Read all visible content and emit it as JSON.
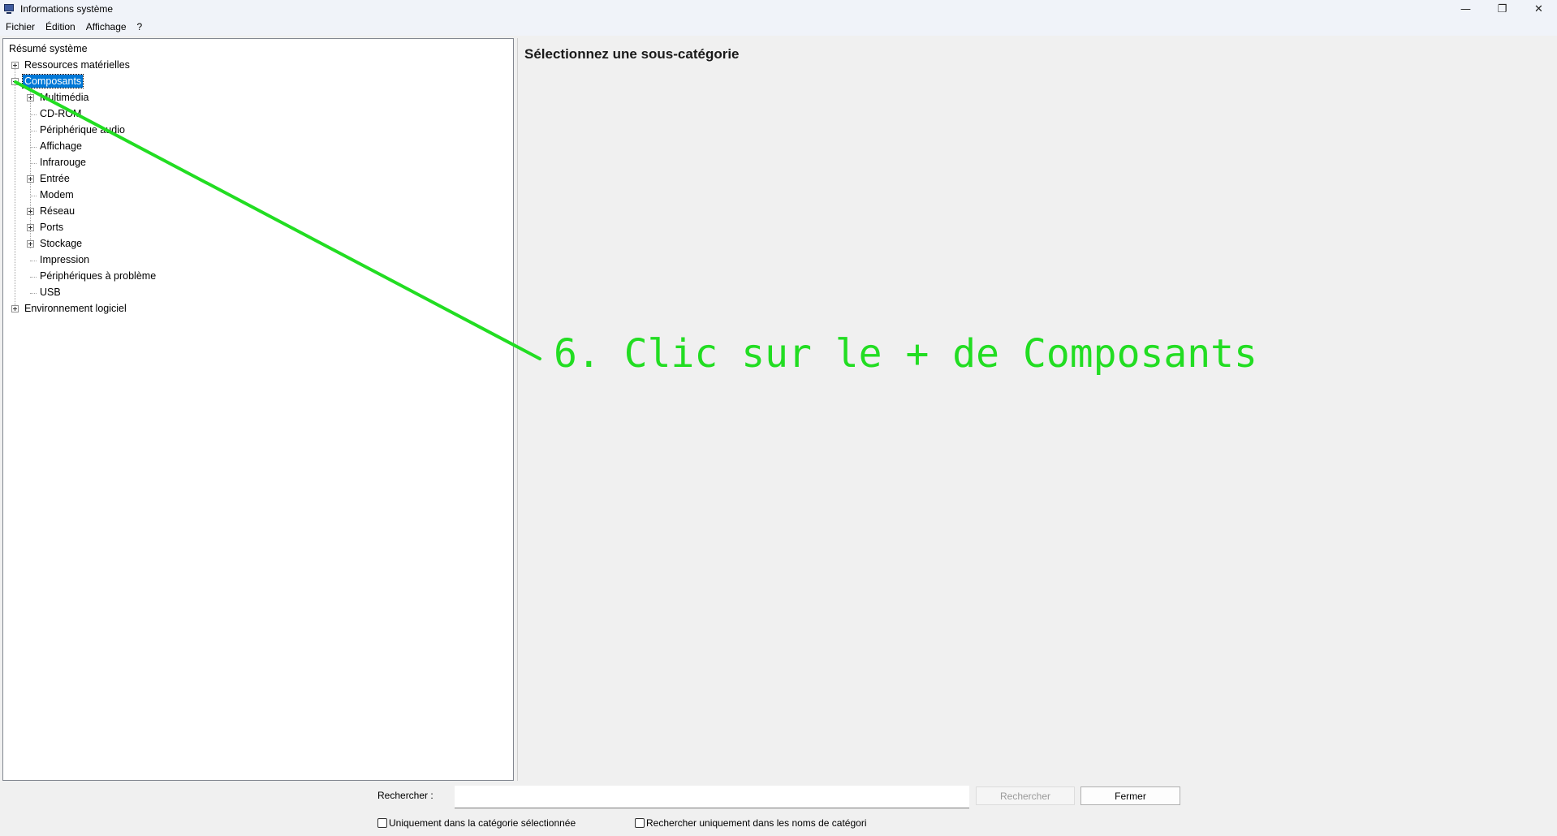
{
  "window": {
    "title": "Informations système",
    "controls": {
      "minimize": "—",
      "maximize": "❐",
      "close": "✕"
    }
  },
  "menu": [
    "Fichier",
    "Édition",
    "Affichage",
    "?"
  ],
  "tree": [
    {
      "label": "Résumé système",
      "level": 0,
      "expander": "none"
    },
    {
      "label": "Ressources matérielles",
      "level": 0,
      "expander": "plus"
    },
    {
      "label": "Composants",
      "level": 0,
      "expander": "minus",
      "selected": true
    },
    {
      "label": "Multimédia",
      "level": 1,
      "expander": "plus"
    },
    {
      "label": "CD-ROM",
      "level": 1,
      "expander": "none"
    },
    {
      "label": "Périphérique audio",
      "level": 1,
      "expander": "none"
    },
    {
      "label": "Affichage",
      "level": 1,
      "expander": "none"
    },
    {
      "label": "Infrarouge",
      "level": 1,
      "expander": "none"
    },
    {
      "label": "Entrée",
      "level": 1,
      "expander": "plus"
    },
    {
      "label": "Modem",
      "level": 1,
      "expander": "none"
    },
    {
      "label": "Réseau",
      "level": 1,
      "expander": "plus"
    },
    {
      "label": "Ports",
      "level": 1,
      "expander": "plus"
    },
    {
      "label": "Stockage",
      "level": 1,
      "expander": "plus"
    },
    {
      "label": "Impression",
      "level": 1,
      "expander": "none"
    },
    {
      "label": "Périphériques à problème",
      "level": 1,
      "expander": "none"
    },
    {
      "label": "USB",
      "level": 1,
      "expander": "none"
    },
    {
      "label": "Environnement logiciel",
      "level": 0,
      "expander": "plus"
    }
  ],
  "content": {
    "heading": "Sélectionnez une sous-catégorie"
  },
  "search": {
    "label": "Rechercher :",
    "value": "",
    "search_button": "Rechercher",
    "close_button": "Fermer",
    "checkbox_category": "Uniquement dans la catégorie sélectionnée",
    "checkbox_names": "Rechercher uniquement dans les noms de catégori"
  },
  "annotation": {
    "text": "6. Clic sur le + de Composants",
    "color": "#22dd22"
  }
}
